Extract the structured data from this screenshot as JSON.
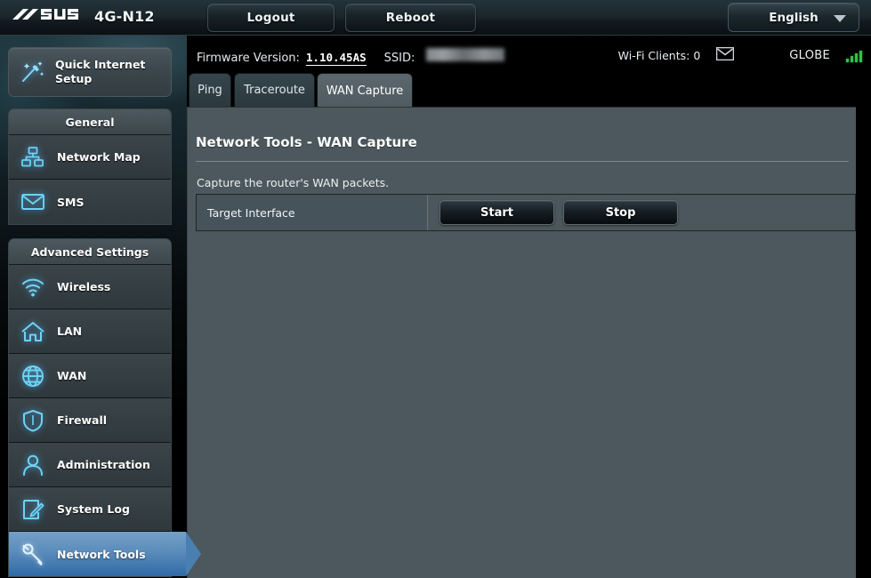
{
  "header": {
    "brand": "ASUS",
    "brand_logo_icon": "asus-logo",
    "model": "4G-N12",
    "logout_label": "Logout",
    "reboot_label": "Reboot",
    "language": "English",
    "language_caret_icon": "chevron-down-icon"
  },
  "infobar": {
    "firmware_label": "Firmware Version:",
    "firmware_value": "1.10.45AS",
    "ssid_label": "SSID:",
    "ssid_value": "",
    "clients_text": "Wi-Fi Clients: 0",
    "mail_icon": "envelope-icon",
    "carrier": "GLOBE",
    "signal_icon": "signal-bars-icon",
    "signal_bars": 4,
    "signal_color": "#2fc14a"
  },
  "tabs": [
    {
      "id": "ping",
      "label": "Ping",
      "active": false
    },
    {
      "id": "traceroute",
      "label": "Traceroute",
      "active": false
    },
    {
      "id": "wancapture",
      "label": "WAN Capture",
      "active": true
    }
  ],
  "main": {
    "title": "Network Tools - WAN Capture",
    "description": "Capture the router's WAN packets.",
    "field_label": "Target Interface",
    "start_label": "Start",
    "stop_label": "Stop"
  },
  "sidebar": {
    "quick_setup": {
      "label": "Quick Internet Setup",
      "icon": "magic-wand-icon"
    },
    "groups": [
      {
        "title": "General",
        "items": [
          {
            "label": "Network Map",
            "icon": "network-map-icon",
            "active": false
          },
          {
            "label": "SMS",
            "icon": "envelope-icon",
            "active": false
          }
        ]
      },
      {
        "title": "Advanced Settings",
        "items": [
          {
            "label": "Wireless",
            "icon": "wifi-icon",
            "active": false
          },
          {
            "label": "LAN",
            "icon": "house-icon",
            "active": false
          },
          {
            "label": "WAN",
            "icon": "globe-icon",
            "active": false
          },
          {
            "label": "Firewall",
            "icon": "shield-icon",
            "active": false
          },
          {
            "label": "Administration",
            "icon": "user-icon",
            "active": false
          },
          {
            "label": "System Log",
            "icon": "pencil-note-icon",
            "active": false
          },
          {
            "label": "Network Tools",
            "icon": "wrench-icon",
            "active": true
          }
        ]
      }
    ]
  },
  "colors": {
    "accent_blue": "#5b8cbb",
    "icon_cyan": "#6fd2f5",
    "panel_bg": "#4c585d",
    "signal_green": "#2fc14a"
  }
}
